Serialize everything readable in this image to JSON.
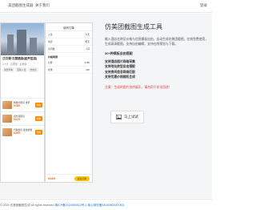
{
  "header": {
    "nav": [
      "美团截图生成器",
      "关于我们"
    ],
    "login": "登录"
  },
  "phone_left": {
    "title": "江口湖·汉庭酒店(经开区店)",
    "meta": "4.7分 · 高档型 · 近地铁",
    "pills": [
      "免费停车",
      "自助入住",
      "洗衣房"
    ],
    "deals": [
      {
        "name": "特惠大床房 含早",
        "price": "¥189",
        "button": "抢购"
      },
      {
        "name": "商务双床房",
        "price": "¥219",
        "button": "抢购"
      },
      {
        "name": "行政套房 连住优惠",
        "price": "¥299",
        "button": "抢购"
      }
    ]
  },
  "phone_right": {
    "header": "填写订单",
    "rows": [
      {
        "k": "入住",
        "v": "今天"
      },
      {
        "k": "离店",
        "v": "明天"
      },
      {
        "k": "房间数",
        "v": "1间"
      }
    ],
    "section": "价格明细",
    "price_rows": [
      {
        "k": "房费",
        "v": "¥189"
      },
      {
        "k": "优惠",
        "v": "-¥20"
      }
    ],
    "total": "¥169",
    "pay": "提交订单"
  },
  "content": {
    "title": "仿美团截图生成工具",
    "description": "输入酒店名称及价格与信息模板自由，自动生成仿美团截图，在线免费使用，生成高清截图，支持自由编辑，支持在线预览与下载。",
    "templates": "30+种模板自由搭配",
    "features": [
      "支持酒店图片网络采集",
      "支持地址房型自由搭配",
      "支持房间信息网络匹配",
      "支持优惠价格随机生成"
    ],
    "warning": "注意：生成的图片仅供娱乐，请勿用于非法用途！",
    "upload_label": "马上试试"
  },
  "footer": {
    "text": "© 2024 仿美团截图生成  All rights reserved",
    "icp": "粤ICP备2024060522号-1",
    "police": "粤公网安备44030602007801"
  }
}
